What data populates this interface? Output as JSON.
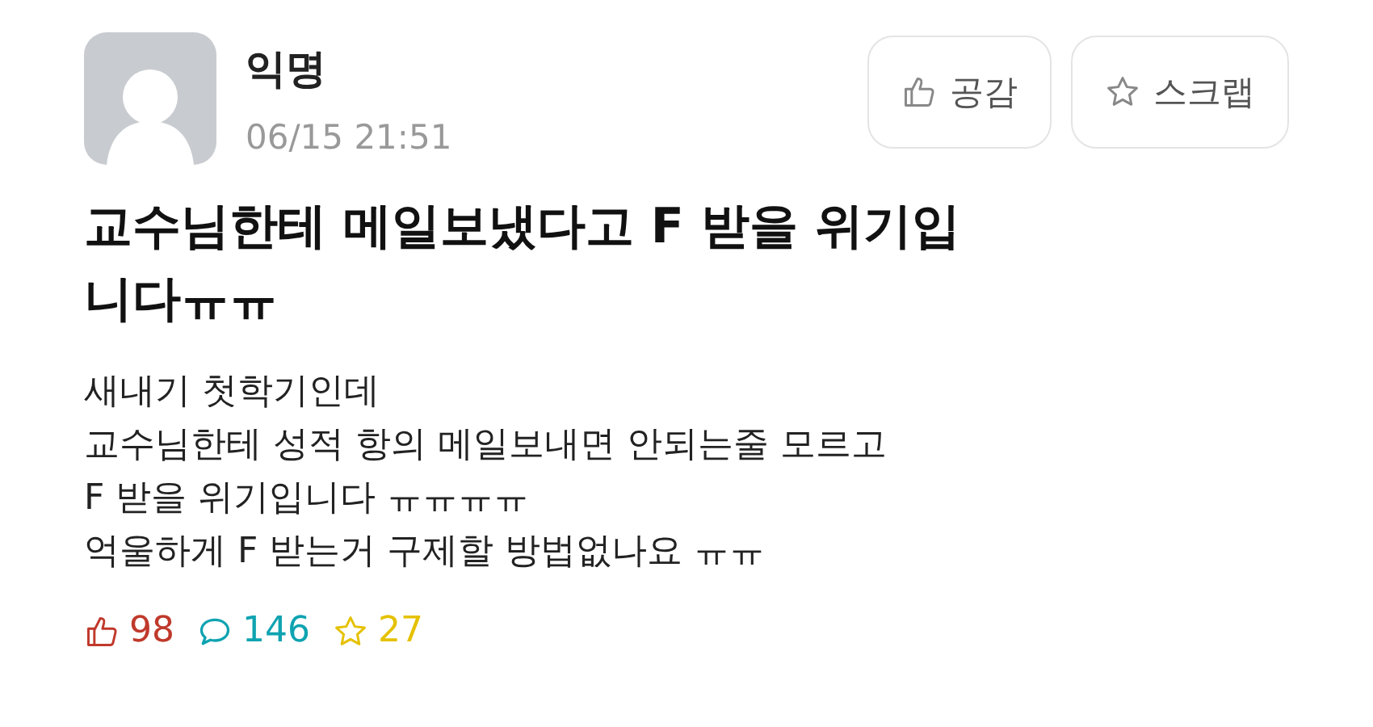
{
  "post": {
    "author": "익명",
    "date": "06/15 21:51",
    "buttons": [
      {
        "kind": "like",
        "label": "공감"
      },
      {
        "kind": "scrap",
        "label": "스크랩"
      }
    ],
    "title": "교수님한테 메일보냈다고 F 받을 위기입니다ㅠㅠ",
    "body": [
      "새내기 첫학기인데",
      "교수님한테 성적 항의 메일보내면 안되는줄 모르고",
      "F 받을 위기입니다 ㅠㅠㅠㅠ",
      "억울하게 F 받는거 구제할 방법없나요 ㅠㅠ"
    ],
    "stats": [
      {
        "kind": "like",
        "count": "98",
        "color": "#c0392b"
      },
      {
        "kind": "comment",
        "count": "146",
        "color": "#0fa3b1"
      },
      {
        "kind": "scrap",
        "count": "27",
        "color": "#e5c100"
      }
    ]
  }
}
